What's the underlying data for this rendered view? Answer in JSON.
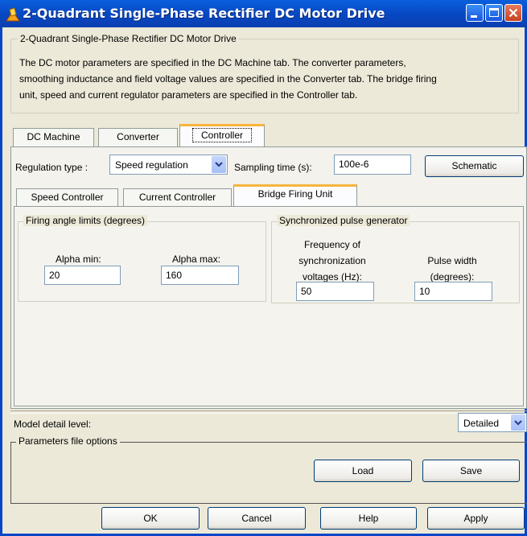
{
  "window": {
    "title": "2-Quadrant Single-Phase Rectifier DC Motor Drive"
  },
  "header": {
    "group_title": "2-Quadrant Single-Phase Rectifier DC Motor Drive",
    "description_lines": [
      "The DC motor parameters are specified in the DC Machine tab. The converter parameters,",
      "smoothing inductance and field voltage values are specified in the Converter tab. The bridge firing",
      "unit, speed and current regulator parameters are specified in the Controller tab."
    ]
  },
  "main_tabs": [
    {
      "label": "DC Machine",
      "active": false
    },
    {
      "label": "Converter",
      "active": false
    },
    {
      "label": "Controller",
      "active": true
    }
  ],
  "controller": {
    "regulation_type_label": "Regulation type :",
    "regulation_type_value": "Speed regulation",
    "sampling_time_label": "Sampling time (s):",
    "sampling_time_value": "100e-6",
    "schematic_label": "Schematic"
  },
  "sub_tabs": [
    {
      "label": "Speed Controller",
      "active": false
    },
    {
      "label": "Current Controller",
      "active": false
    },
    {
      "label": "Bridge Firing Unit",
      "active": true
    }
  ],
  "firing_unit": {
    "firing_limits_title": "Firing angle limits (degrees)",
    "alpha_min_label": "Alpha min:",
    "alpha_min_value": "20",
    "alpha_max_label": "Alpha max:",
    "alpha_max_value": "160",
    "sync_title": "Synchronized pulse generator",
    "freq_label_lines": [
      "Frequency of",
      "synchronization",
      "voltages (Hz):"
    ],
    "freq_value": "50",
    "pulse_label_lines": [
      "Pulse width",
      "(degrees):"
    ],
    "pulse_value": "10"
  },
  "model_detail": {
    "label": "Model detail level:",
    "value": "Detailed"
  },
  "params_file": {
    "title": "Parameters file options",
    "load_label": "Load",
    "save_label": "Save"
  },
  "footer": {
    "ok_label": "OK",
    "cancel_label": "Cancel",
    "help_label": "Help",
    "apply_label": "Apply"
  },
  "colors": {
    "titlebar": "#0a5fdc",
    "window_bg": "#ece9d8",
    "active_tab_accent": "#f7b43f",
    "close_button": "#c8411d"
  },
  "icons": {
    "app": "simulink-icon",
    "dropdown": "chevron-down-icon"
  }
}
